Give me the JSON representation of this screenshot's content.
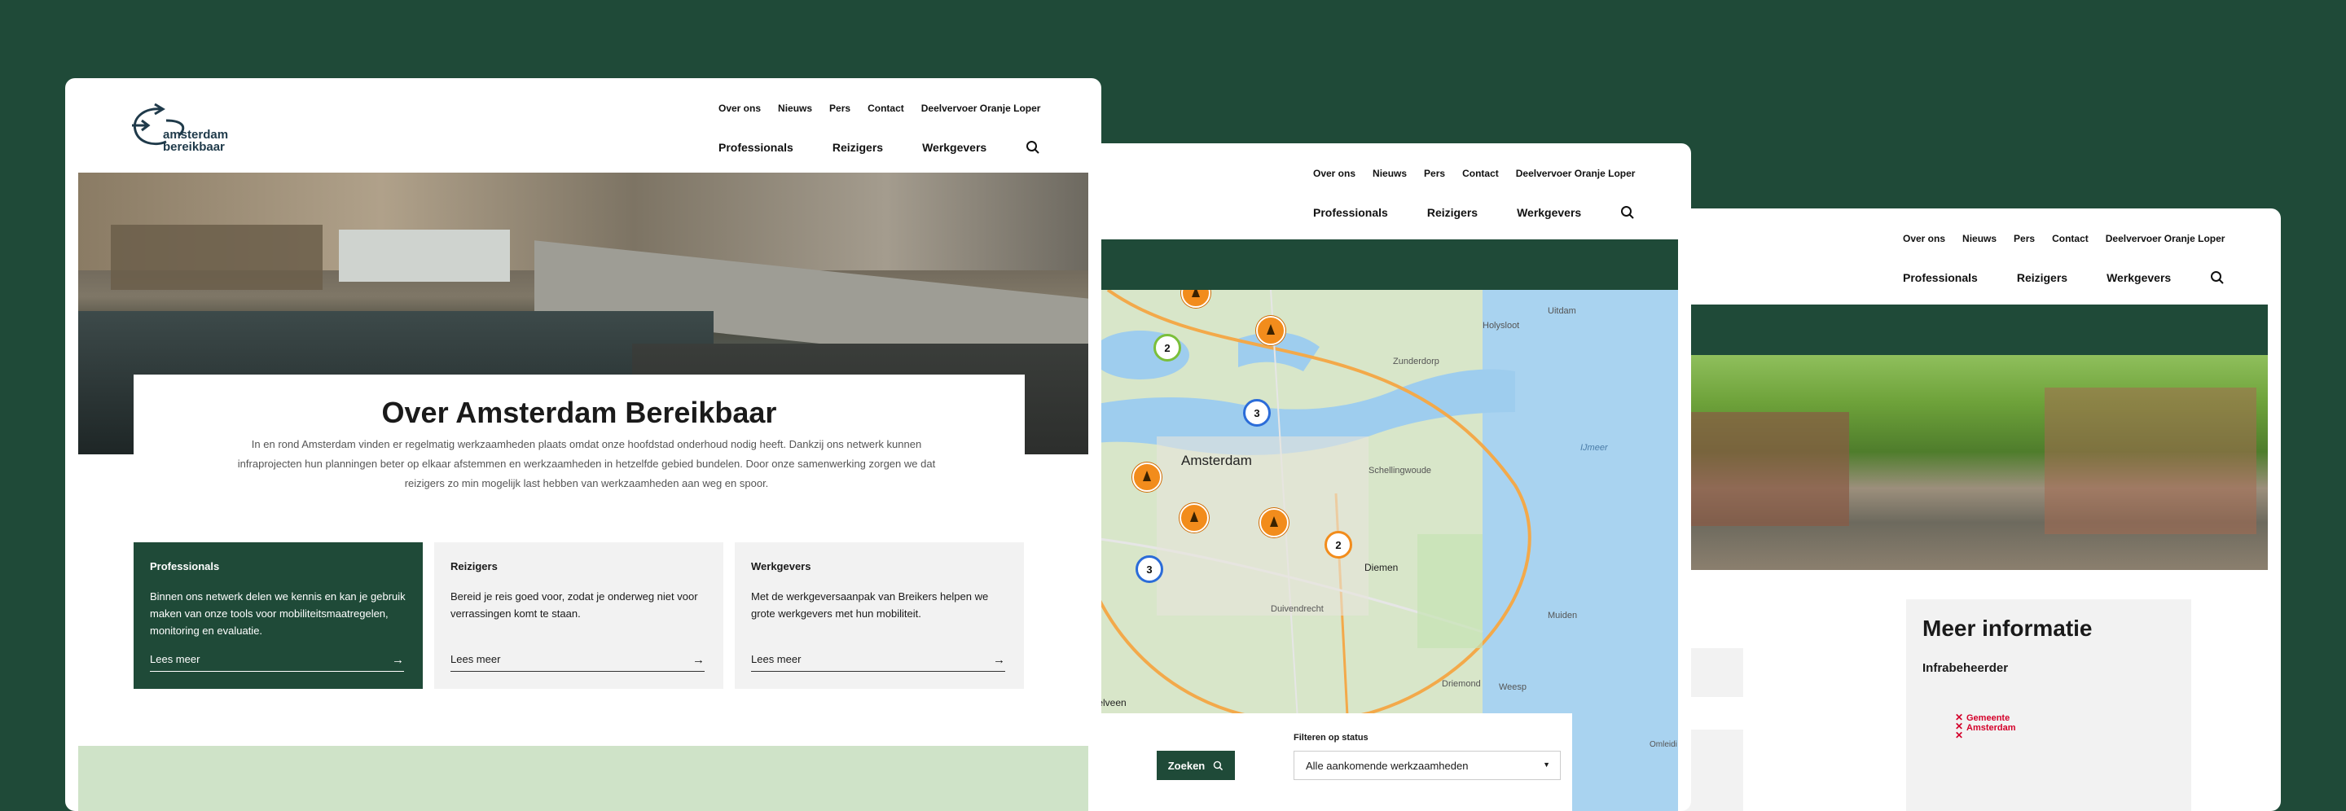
{
  "nav": {
    "top_links": [
      "Over ons",
      "Nieuws",
      "Pers",
      "Contact",
      "Deelvervoer Oranje Loper"
    ],
    "main_items": [
      "Professionals",
      "Reizigers",
      "Werkgevers"
    ]
  },
  "logo": {
    "line1": "amsterdam",
    "line2": "bereikbaar"
  },
  "about": {
    "title": "Over Amsterdam Bereikbaar",
    "intro": "In en rond Amsterdam vinden er regelmatig werkzaamheden plaats omdat onze hoofdstad onderhoud nodig heeft. Dankzij ons netwerk kunnen infraprojecten hun planningen beter op elkaar afstemmen en werkzaamheden in hetzelfde gebied bundelen. Door onze samenwerking zorgen we dat reizigers zo min mogelijk last hebben van werkzaamheden aan weg en spoor."
  },
  "tiles": [
    {
      "title": "Professionals",
      "text": "Binnen ons netwerk delen we kennis en kan je gebruik maken van onze tools voor mobiliteitsmaatregelen, monitoring en evaluatie.",
      "link": "Lees meer"
    },
    {
      "title": "Reizigers",
      "text": "Bereid je reis goed voor, zodat je onderweg niet voor verrassingen komt te staan.",
      "link": "Lees meer"
    },
    {
      "title": "Werkgevers",
      "text": "Met de werkgeversaanpak van Breikers helpen we grote werkgevers met hun mobiliteit.",
      "link": "Lees meer"
    }
  ],
  "map": {
    "labels": [
      "Amsterdam",
      "Diemen",
      "Duivendrecht",
      "Amstelveen",
      "Weesp",
      "Muiden",
      "Schellingwoude",
      "Zunderdorp",
      "Uitdam",
      "Holysloot",
      "IJmeer",
      "Driemond",
      "Omleidi"
    ],
    "cluster_counts": [
      "2",
      "3",
      "3",
      "2"
    ],
    "search_button": "Zoeken",
    "filter_label": "Filteren op status",
    "filter_value": "Alle aankomende werkzaamheden"
  },
  "info": {
    "title": "Meer informatie",
    "subtitle": "Infrabeheerder",
    "gemeente": [
      "Gemeente",
      "Amsterdam"
    ]
  },
  "colors": {
    "brand_green": "#1f4a38",
    "pin_orange": "#f28c1c",
    "gemeente_red": "#d4002a"
  }
}
